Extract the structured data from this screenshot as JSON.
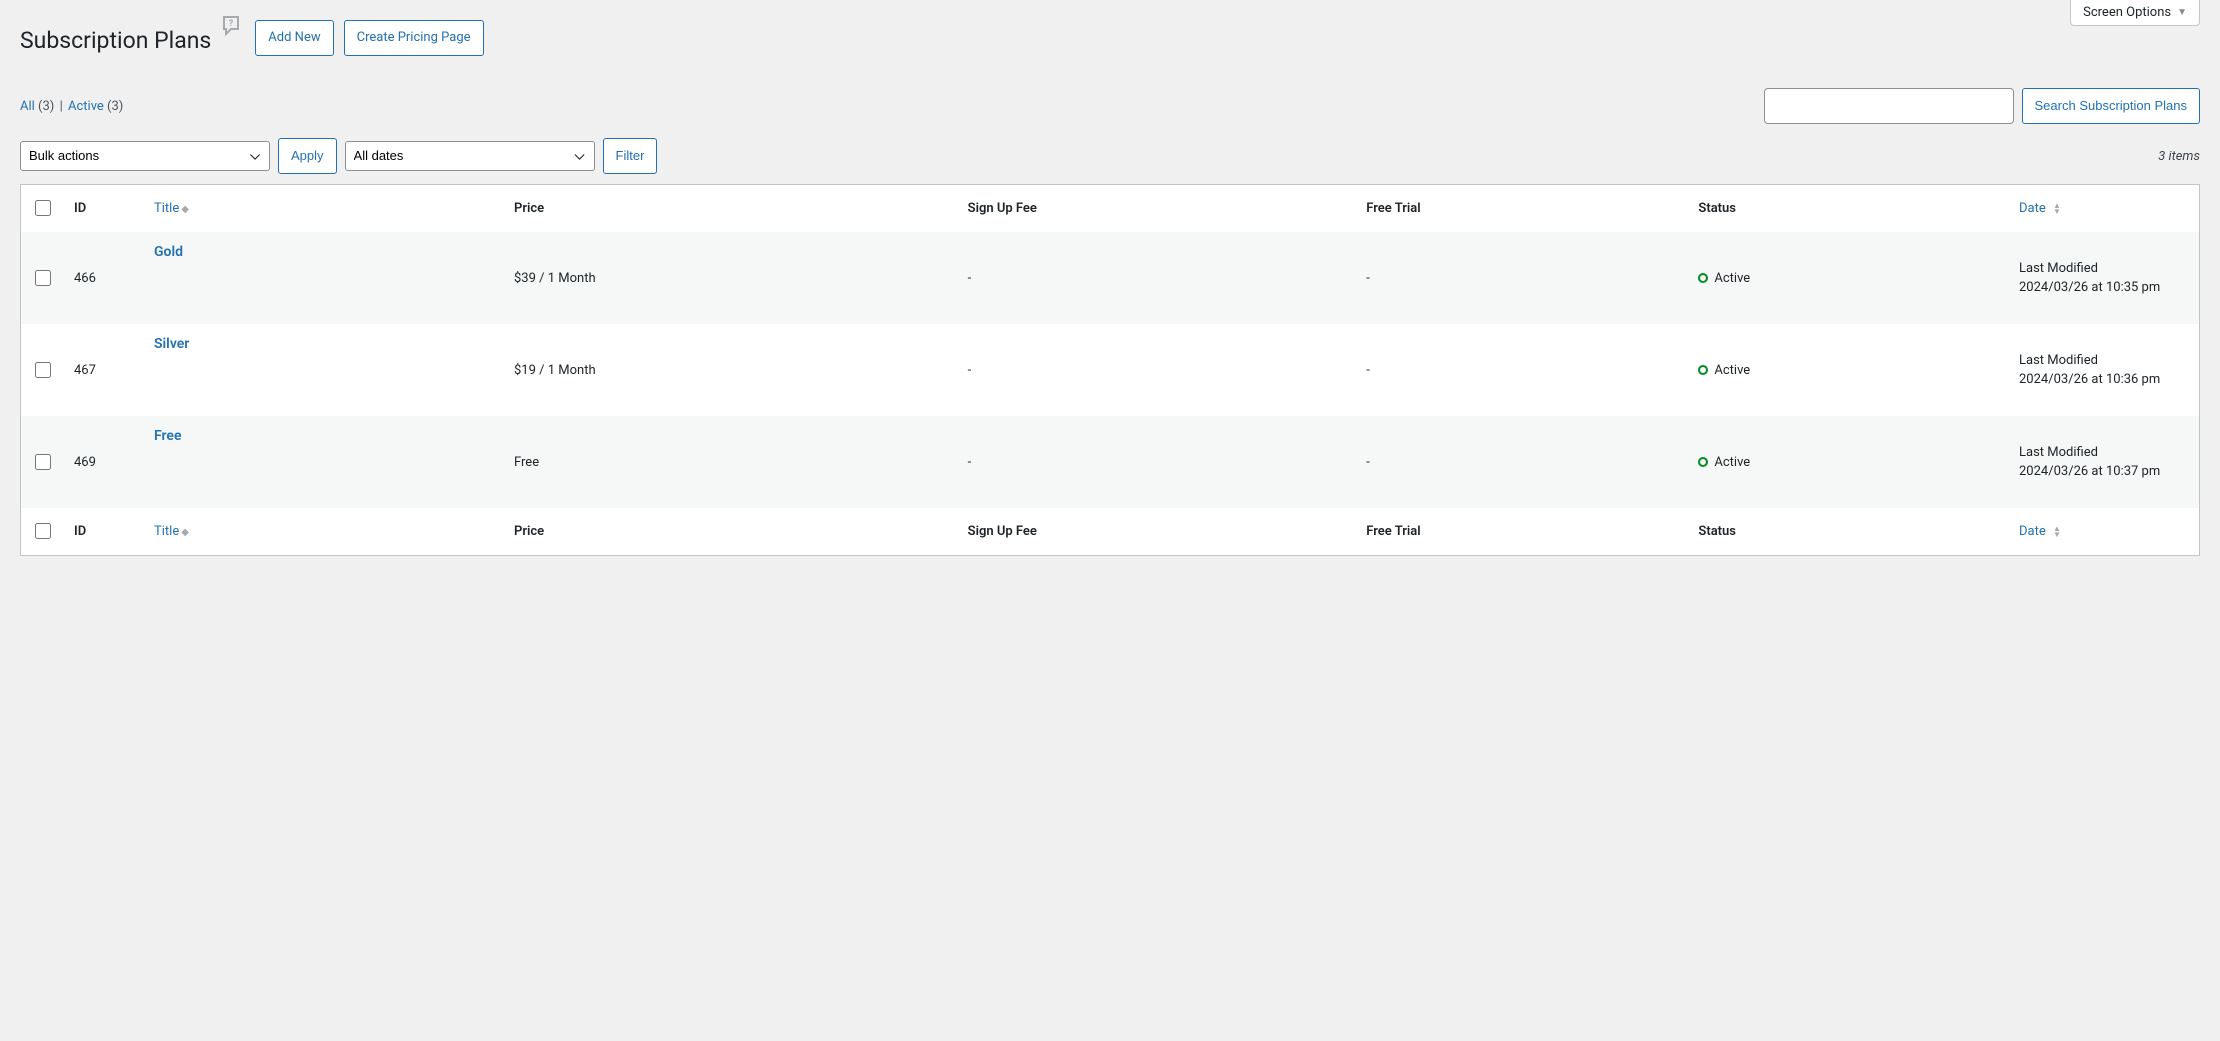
{
  "screen_options": "Screen Options",
  "header": {
    "title": "Subscription Plans",
    "add_new": "Add New",
    "create_pricing": "Create Pricing Page"
  },
  "filters": {
    "all_label": "All",
    "all_count": "(3)",
    "sep": "|",
    "active_label": "Active",
    "active_count": "(3)"
  },
  "search": {
    "button": "Search Subscription Plans"
  },
  "bulk": {
    "bulk_actions": "Bulk actions",
    "apply": "Apply",
    "all_dates": "All dates",
    "filter": "Filter"
  },
  "items_count": "3 items",
  "columns": {
    "id": "ID",
    "title": "Title",
    "price": "Price",
    "signup": "Sign Up Fee",
    "trial": "Free Trial",
    "status": "Status",
    "date": "Date"
  },
  "rows": [
    {
      "id": "466",
      "title": "Gold",
      "price": "$39 / 1 Month",
      "signup": "-",
      "trial": "-",
      "status": "Active",
      "date_label": "Last Modified",
      "date_value": "2024/03/26 at 10:35 pm"
    },
    {
      "id": "467",
      "title": "Silver",
      "price": "$19 / 1 Month",
      "signup": "-",
      "trial": "-",
      "status": "Active",
      "date_label": "Last Modified",
      "date_value": "2024/03/26 at 10:36 pm"
    },
    {
      "id": "469",
      "title": "Free",
      "price": "Free",
      "signup": "-",
      "trial": "-",
      "status": "Active",
      "date_label": "Last Modified",
      "date_value": "2024/03/26 at 10:37 pm"
    }
  ]
}
